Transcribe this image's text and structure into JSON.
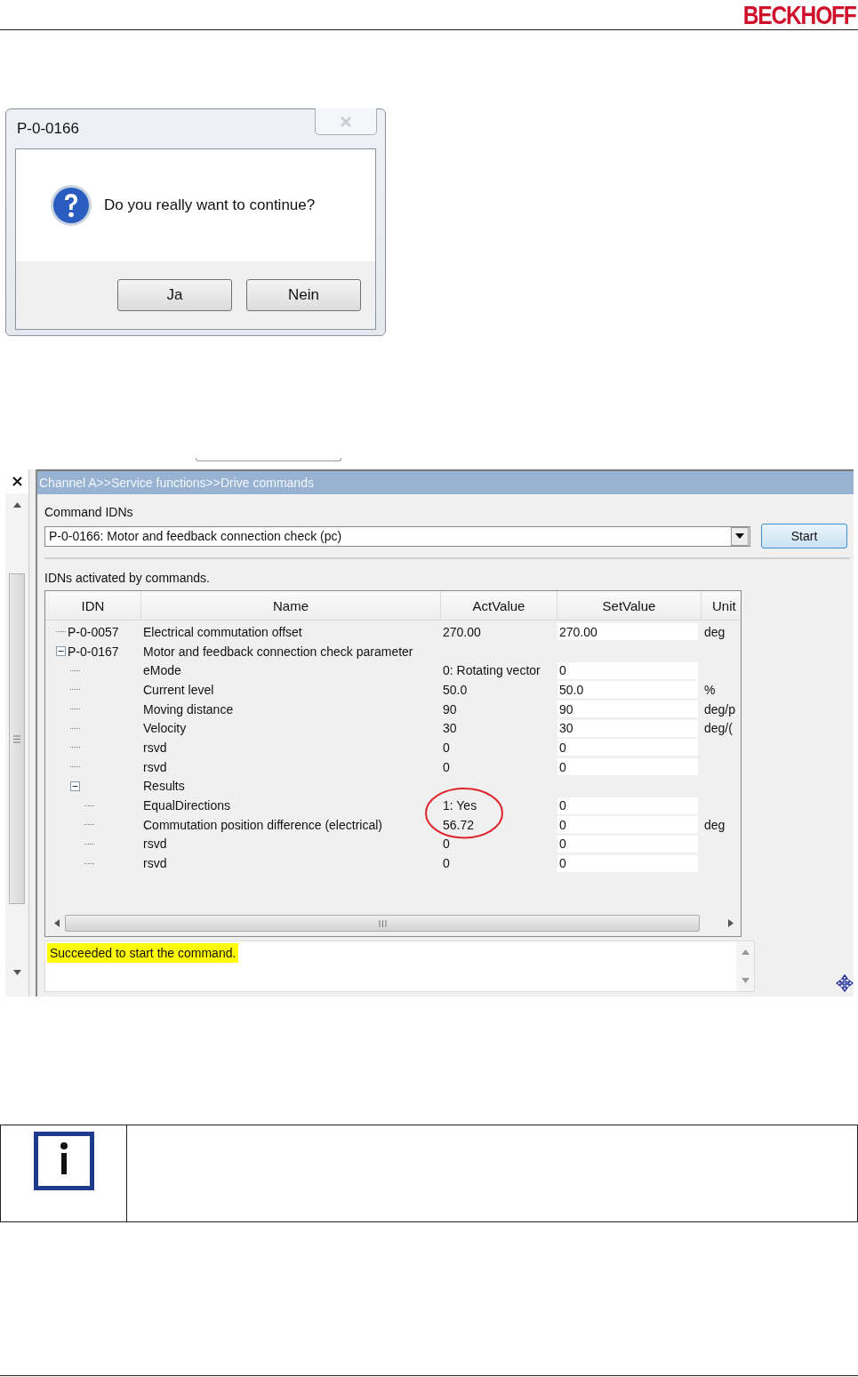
{
  "header": {
    "logo": "BECKHOFF"
  },
  "dialog": {
    "title": "P-0-0166",
    "message": "Do you really want to continue?",
    "buttons": [
      "Ja",
      "Nein"
    ]
  },
  "drive_window": {
    "title": "Channel A>>Service functions>>Drive commands",
    "command_label": "Command IDNs",
    "command_value": "P-0-0166: Motor and feedback connection check (pc)",
    "start_button": "Start",
    "table_label": "IDNs activated by commands.",
    "columns": [
      "IDN",
      "Name",
      "ActValue",
      "SetValue",
      "Unit"
    ],
    "rows": [
      {
        "idn": "P-0-0057",
        "name": "Electrical commutation offset",
        "act": "270.00",
        "set": "270.00",
        "unit": "deg"
      },
      {
        "idn": "P-0-0167",
        "name": "Motor and feedback connection check parameter",
        "expanded": true,
        "children": [
          {
            "name": "eMode",
            "act": "0: Rotating vector",
            "set": "0"
          },
          {
            "name": "Current level",
            "act": "50.0",
            "set": "50.0",
            "unit": "%"
          },
          {
            "name": "Moving distance",
            "act": "90",
            "set": "90",
            "unit": "deg/p"
          },
          {
            "name": "Velocity",
            "act": "30",
            "set": "30",
            "unit": "deg/("
          },
          {
            "name": "rsvd",
            "act": "0",
            "set": "0"
          },
          {
            "name": "rsvd",
            "act": "0",
            "set": "0"
          },
          {
            "name": "Results",
            "expanded": true,
            "children": [
              {
                "name": "EqualDirections",
                "act": "1: Yes",
                "set": "0",
                "circled": true
              },
              {
                "name": "Commutation position difference (electrical)",
                "act": "56.72",
                "set": "0",
                "unit": "deg",
                "circled": true
              },
              {
                "name": "rsvd",
                "act": "0",
                "set": "0"
              },
              {
                "name": "rsvd",
                "act": "0",
                "set": "0"
              }
            ]
          }
        ]
      }
    ],
    "message": "Succeeded to start the command."
  }
}
